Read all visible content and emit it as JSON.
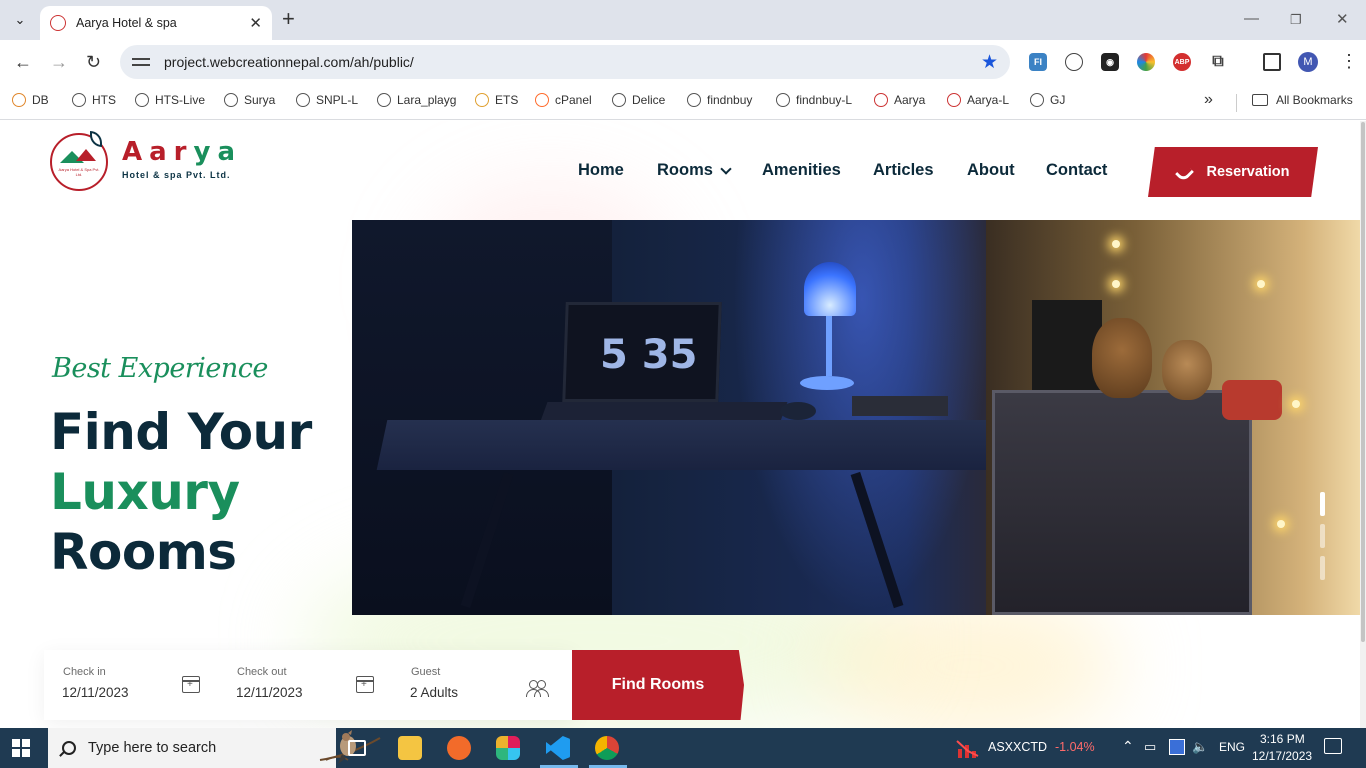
{
  "browser": {
    "tab_title": "Aarya Hotel & spa",
    "url": "project.webcreationnepal.com/ah/public/",
    "profile_initial": "M",
    "extensions": [
      {
        "name": "fi-ext-icon",
        "label": "FI",
        "color": "#3b82c4"
      },
      {
        "name": "circle-ext-icon",
        "label": "◐",
        "color": "#666666"
      },
      {
        "name": "camera-ext-icon",
        "label": "◉",
        "color": "#222222"
      },
      {
        "name": "color-ext-icon",
        "label": "●",
        "color": "#e0872c"
      },
      {
        "name": "adblock-ext-icon",
        "label": "ABP",
        "color": "#d32f2f"
      },
      {
        "name": "puzzle-ext-icon",
        "label": "⧉",
        "color": "#444444"
      }
    ],
    "bookmarks": [
      "DB",
      "HTS",
      "HTS-Live",
      "Surya",
      "SNPL-L",
      "Lara_playg",
      "ETS",
      "cPanel",
      "Delice",
      "findnbuy",
      "findnbuy-L",
      "Aarya",
      "Aarya-L",
      "GJ"
    ],
    "all_bookmarks": "All Bookmarks"
  },
  "site": {
    "logo": {
      "name_red": "Aar",
      "name_green": "ya",
      "subtitle": "Hotel & spa Pvt. Ltd.",
      "badge_text": "Aarya Hotel & Spa Pvt. Ltd."
    },
    "nav": {
      "home": "Home",
      "rooms": "Rooms",
      "amenities": "Amenities",
      "articles": "Articles",
      "about": "About",
      "contact": "Contact"
    },
    "reservation_label": "Reservation",
    "hero": {
      "tagline": "Best Experience",
      "line1": "Find Your",
      "line2": "Luxury",
      "line3": "Rooms",
      "clock": "5 35",
      "slides": 3,
      "active_slide": 1
    },
    "booking": {
      "checkin_label": "Check in",
      "checkin_value": "12/11/2023",
      "checkout_label": "Check out",
      "checkout_value": "12/11/2023",
      "guest_label": "Guest",
      "guest_value": "2 Adults",
      "find_label": "Find Rooms"
    },
    "colors": {
      "brand_red": "#b81f2a",
      "brand_green": "#1a8f5c",
      "navy": "#0c2a3a"
    }
  },
  "taskbar": {
    "search_placeholder": "Type here to search",
    "stock_symbol": "ASXXCTD",
    "stock_change": "-1.04%",
    "language": "ENG",
    "time": "3:16 PM",
    "date": "12/17/2023"
  }
}
